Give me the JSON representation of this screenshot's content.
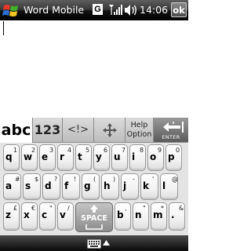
{
  "titlebar": {
    "app_title": "Word Mobile",
    "g_badge": "G",
    "clock": "14:06",
    "ok_label": "ok"
  },
  "keyboard": {
    "tabs": {
      "abc": "abc",
      "num": "123",
      "sym": "<!>",
      "help_line1": "Help",
      "help_line2": "Option",
      "enter": "ENTER"
    },
    "rows": [
      [
        {
          "p": "q",
          "s": "1"
        },
        {
          "p": "w",
          "s": "2"
        },
        {
          "p": "e",
          "s": "3"
        },
        {
          "p": "r",
          "s": "4"
        },
        {
          "p": "t",
          "s": "5"
        },
        {
          "p": "y",
          "s": "6"
        },
        {
          "p": "u",
          "s": "7"
        },
        {
          "p": "i",
          "s": "8"
        },
        {
          "p": "o",
          "s": "9"
        },
        {
          "p": "p",
          "s": "0"
        }
      ],
      [
        {
          "p": "a",
          "s": "#"
        },
        {
          "p": "s",
          "s": "$"
        },
        {
          "p": "d",
          "s": "?"
        },
        {
          "p": "f",
          "s": "!"
        },
        {
          "p": "g",
          "s": "("
        },
        {
          "p": "h",
          "s": ")"
        },
        {
          "p": "j",
          "s": "-"
        },
        {
          "p": "k",
          "s": "'"
        },
        {
          "p": "l",
          "s": "@"
        }
      ],
      [
        {
          "p": "z",
          "s": "£"
        },
        {
          "p": "x",
          "s": "€"
        },
        {
          "p": "c",
          "s": "\""
        },
        {
          "p": "v",
          "s": "/"
        },
        {
          "p": "b",
          "s": ","
        },
        {
          "p": "n",
          "s": "\""
        },
        {
          "p": "m",
          "s": "*"
        },
        {
          "p": ".",
          "s": "&"
        }
      ]
    ],
    "space_label": "SPACE"
  }
}
